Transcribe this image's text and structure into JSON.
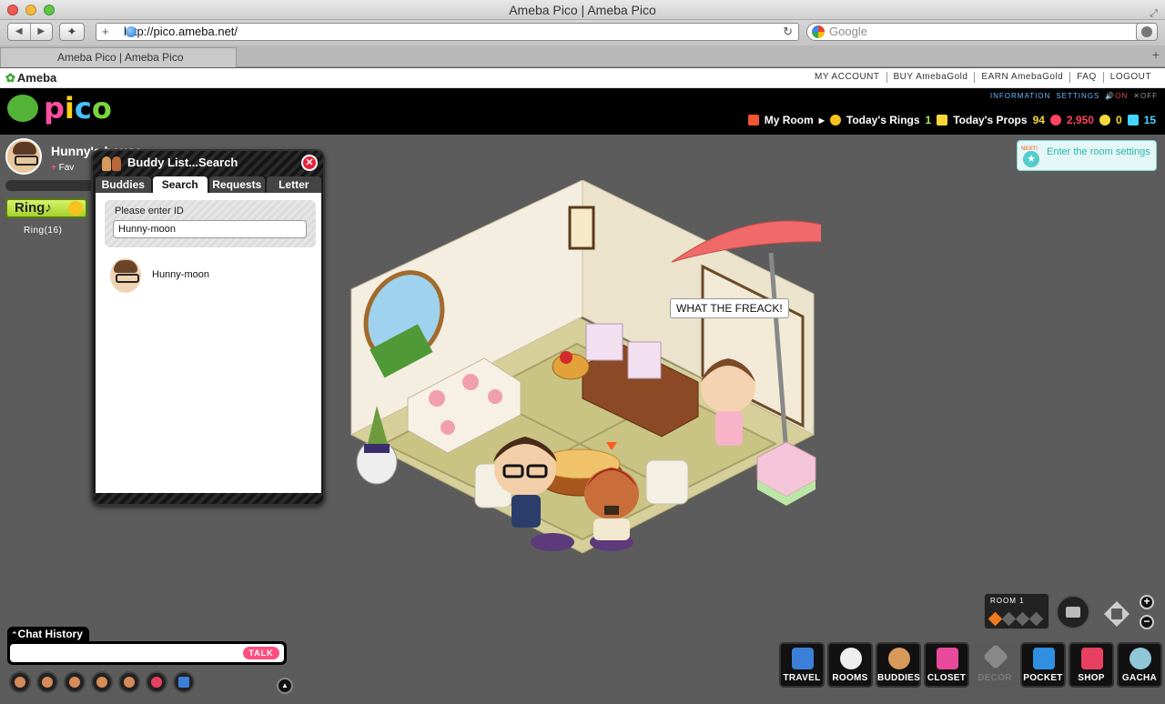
{
  "window": {
    "title": "Ameba Pico | Ameba Pico"
  },
  "browser": {
    "url": "http://pico.ameba.net/",
    "search_placeholder": "Google",
    "tab_title": "Ameba Pico | Ameba Pico"
  },
  "ameba_bar": {
    "logo": "Ameba",
    "links": [
      "MY ACCOUNT",
      "BUY AmebaGold",
      "EARN AmebaGold",
      "FAQ",
      "LOGOUT"
    ]
  },
  "pico_bar": {
    "logo": "pico",
    "info_links": [
      "INFORMATION",
      "SETTINGS",
      "ON",
      "OFF"
    ],
    "my_room": "My Room",
    "rings_label": "Today's Rings",
    "rings_value": "1",
    "props_label": "Today's Props",
    "props_value": "94",
    "coins": "2,950",
    "gold": "0",
    "level": "15"
  },
  "owner": {
    "name": "Hunny's house",
    "fav": "Fav"
  },
  "ring": {
    "label": "Ring♪",
    "count": "Ring(16)"
  },
  "room_settings": {
    "next": "NEXT!",
    "text": "Enter the room settings"
  },
  "buddy_panel": {
    "title": "Buddy List...Search",
    "tabs": [
      "Buddies",
      "Search",
      "Requests",
      "Letter"
    ],
    "active_tab": "Search",
    "prompt": "Please enter ID",
    "input_value": "Hunny-moon",
    "result_name": "Hunny-moon"
  },
  "room": {
    "speech": "WHAT THE FREACK!"
  },
  "chat": {
    "history_label": "Chat History",
    "talk": "TALK"
  },
  "room_selector": {
    "label": "ROOM 1"
  },
  "dock": [
    "TRAVEL",
    "ROOMS",
    "BUDDIES",
    "CLOSET",
    "DECOR",
    "POCKET",
    "SHOP",
    "GACHA"
  ],
  "colors": {
    "accent_pink": "#ff4f7f",
    "teal": "#28b5b8",
    "pico_green": "#52b337"
  }
}
